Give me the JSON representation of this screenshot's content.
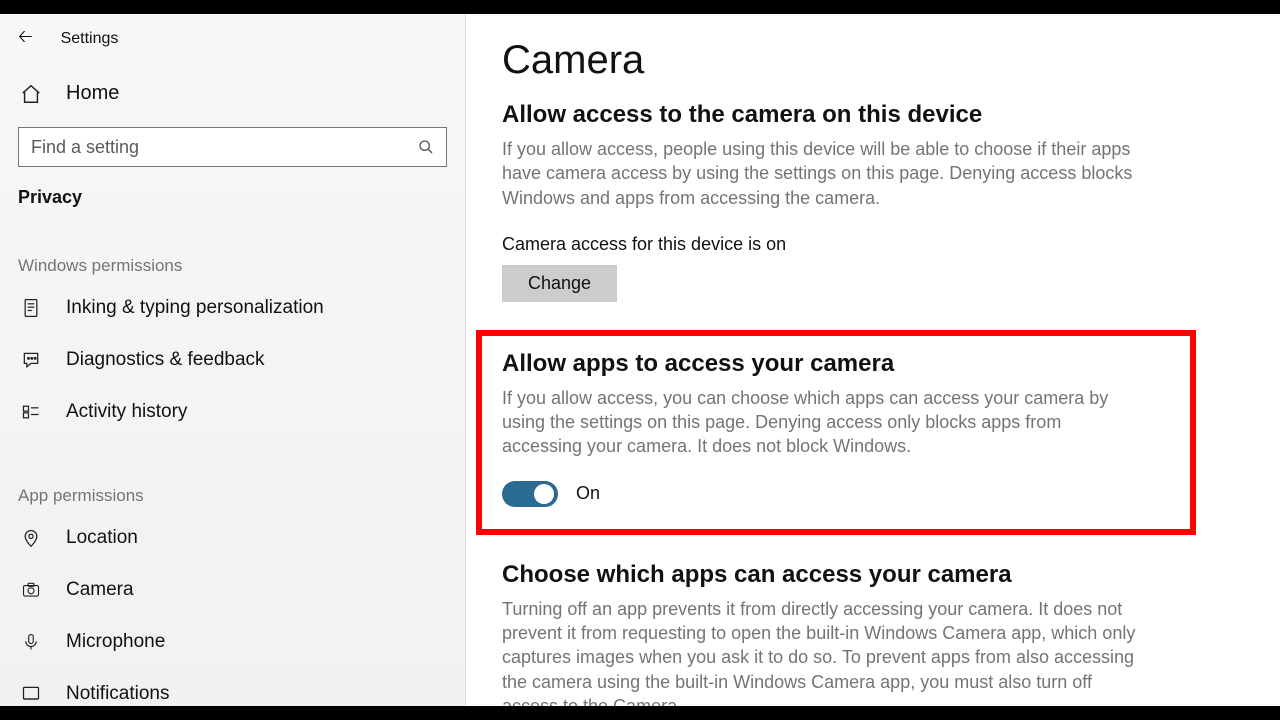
{
  "titlebar": {
    "title": "Settings"
  },
  "sidebar": {
    "home": "Home",
    "search_placeholder": "Find a setting",
    "category": "Privacy",
    "group1_label": "Windows permissions",
    "group1_items": [
      {
        "label": "Inking & typing personalization"
      },
      {
        "label": "Diagnostics & feedback"
      },
      {
        "label": "Activity history"
      }
    ],
    "group2_label": "App permissions",
    "group2_items": [
      {
        "label": "Location"
      },
      {
        "label": "Camera"
      },
      {
        "label": "Microphone"
      },
      {
        "label": "Notifications"
      }
    ]
  },
  "main": {
    "title": "Camera",
    "section1": {
      "heading": "Allow access to the camera on this device",
      "body": "If you allow access, people using this device will be able to choose if their apps have camera access by using the settings on this page. Denying access blocks Windows and apps from accessing the camera.",
      "status": "Camera access for this device is on",
      "change_label": "Change"
    },
    "section2": {
      "heading": "Allow apps to access your camera",
      "body": "If you allow access, you can choose which apps can access your camera by using the settings on this page. Denying access only blocks apps from accessing your camera. It does not block Windows.",
      "toggle_state": "On"
    },
    "section3": {
      "heading": "Choose which apps can access your camera",
      "body": "Turning off an app prevents it from directly accessing your camera. It does not prevent it from requesting to open the built-in Windows Camera app, which only captures images when you ask it to do so. To prevent apps from also accessing the camera using the built-in Windows Camera app, you must also turn off access to the Camera"
    }
  }
}
